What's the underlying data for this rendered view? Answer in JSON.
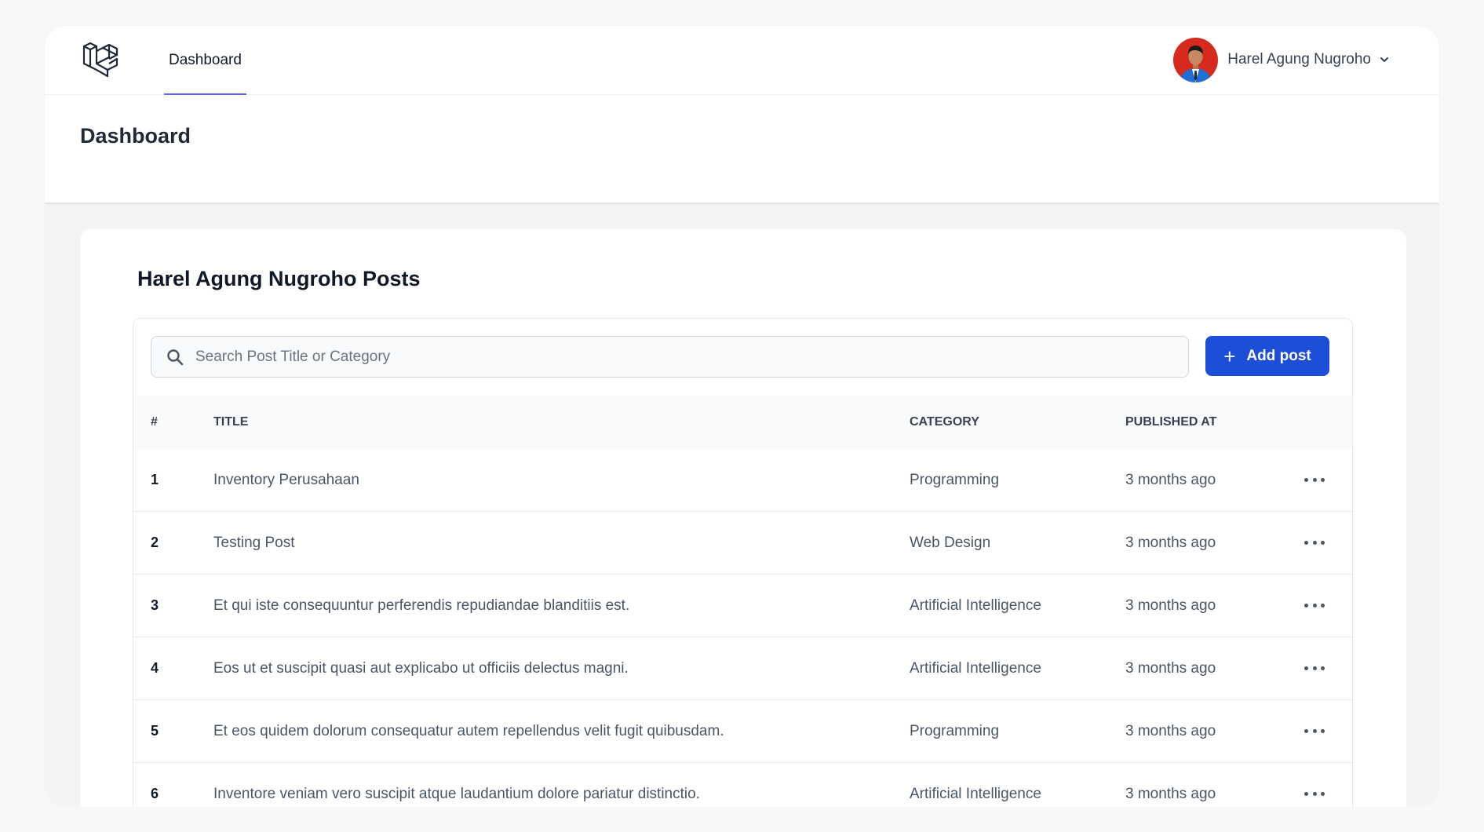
{
  "nav": {
    "dashboard_link": "Dashboard"
  },
  "user": {
    "name": "Harel Agung Nugroho"
  },
  "header": {
    "title": "Dashboard"
  },
  "posts": {
    "heading": "Harel Agung Nugroho Posts",
    "search_placeholder": "Search Post Title or Category",
    "add_button": "Add post",
    "columns": [
      "#",
      "Title",
      "Category",
      "Published At"
    ],
    "rows": [
      {
        "num": "1",
        "title": "Inventory Perusahaan",
        "category": "Programming",
        "published": "3 months ago"
      },
      {
        "num": "2",
        "title": "Testing Post",
        "category": "Web Design",
        "published": "3 months ago"
      },
      {
        "num": "3",
        "title": "Et qui iste consequuntur perferendis repudiandae blanditiis est.",
        "category": "Artificial Intelligence",
        "published": "3 months ago"
      },
      {
        "num": "4",
        "title": "Eos ut et suscipit quasi aut explicabo ut officiis delectus magni.",
        "category": "Artificial Intelligence",
        "published": "3 months ago"
      },
      {
        "num": "5",
        "title": "Et eos quidem dolorum consequatur autem repellendus velit fugit quibusdam.",
        "category": "Programming",
        "published": "3 months ago"
      },
      {
        "num": "6",
        "title": "Inventore veniam vero suscipit atque laudantium dolore pariatur distinctio.",
        "category": "Artificial Intelligence",
        "published": "3 months ago"
      }
    ]
  },
  "colors": {
    "accent": "#1d4ed8",
    "nav_underline": "#6366f1",
    "background": "#f3f4f6"
  },
  "icons": {
    "logo": "laravel-logo-icon",
    "search": "search-icon",
    "chevron": "chevron-down-icon",
    "add": "plus-icon",
    "row_actions": "more-horizontal-icon"
  }
}
